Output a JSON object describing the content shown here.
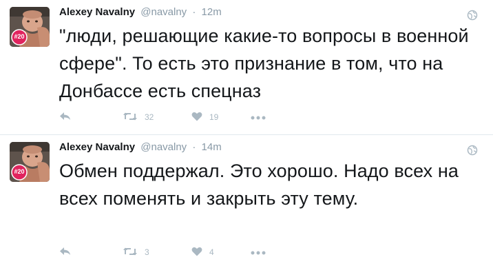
{
  "tweets": [
    {
      "author_name": "Alexey Navalny",
      "handle": "@navalny",
      "separator": "·",
      "time": "12m",
      "text": "\"люди, решающие какие-то вопросы в военной сфере\". То есть это признание в том, что на Донбассе есть спецназ",
      "retweets": "32",
      "likes": "19",
      "avatar_badge": "#20"
    },
    {
      "author_name": "Alexey Navalny",
      "handle": "@navalny",
      "separator": "·",
      "time": "14m",
      "text": "Обмен поддержал. Это хорошо. Надо всех на всех поменять и закрыть эту тему.",
      "retweets": "3",
      "likes": "4",
      "avatar_badge": "#20"
    }
  ],
  "colors": {
    "muted": "#8899a6",
    "icon": "#aab8c2",
    "badge": "#e0245e",
    "divider": "#e1e8ed"
  }
}
